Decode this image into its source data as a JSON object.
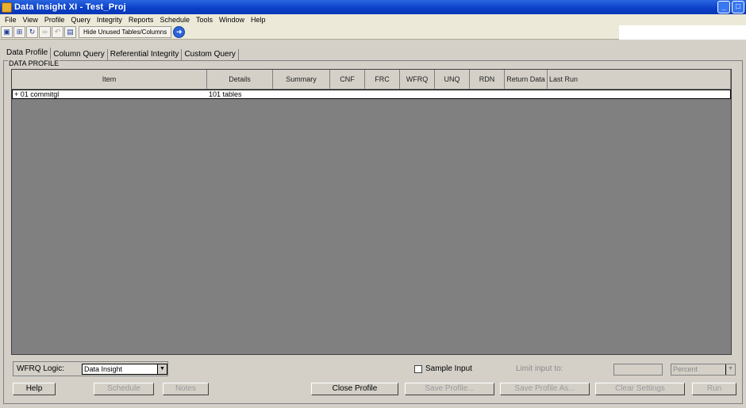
{
  "window": {
    "title": "Data Insight XI - Test_Proj",
    "controls": [
      "_",
      "□"
    ]
  },
  "menu": [
    "File",
    "View",
    "Profile",
    "Query",
    "Integrity",
    "Reports",
    "Schedule",
    "Tools",
    "Window",
    "Help"
  ],
  "toolbar": {
    "icons": [
      "open-icon",
      "export-icon",
      "refresh-icon",
      "binoculars-icon",
      "undo-icon",
      "properties-icon"
    ],
    "hide_unused_label": "Hide Unused Tables/Columns",
    "go_icon": "go-icon"
  },
  "tabs": [
    "Data Profile",
    "Column Query",
    "Referential Integrity",
    "Custom Query"
  ],
  "group_label": "DATA PROFILE",
  "table": {
    "columns": [
      "Item",
      "Details",
      "Summary",
      "CNF",
      "FRC",
      "WFRQ",
      "UNQ",
      "RDN",
      "Return Data",
      "Last Run"
    ],
    "rows": [
      {
        "item": "+ 01 commitgl",
        "details": "101 tables"
      }
    ]
  },
  "wfrq": {
    "label": "WFRQ Logic:",
    "value": "Data Insight"
  },
  "sample": {
    "label": "Sample Input",
    "checked": false
  },
  "limit": {
    "label": "Limit input to:",
    "value": "",
    "unit": "Percent"
  },
  "buttons": {
    "help": "Help",
    "schedule": "Schedule",
    "notes": "Notes",
    "close_profile": "Close Profile",
    "save_profile": "Save Profile...",
    "save_profile_as": "Save Profile As...",
    "clear_settings": "Clear Settings",
    "run": "Run"
  }
}
